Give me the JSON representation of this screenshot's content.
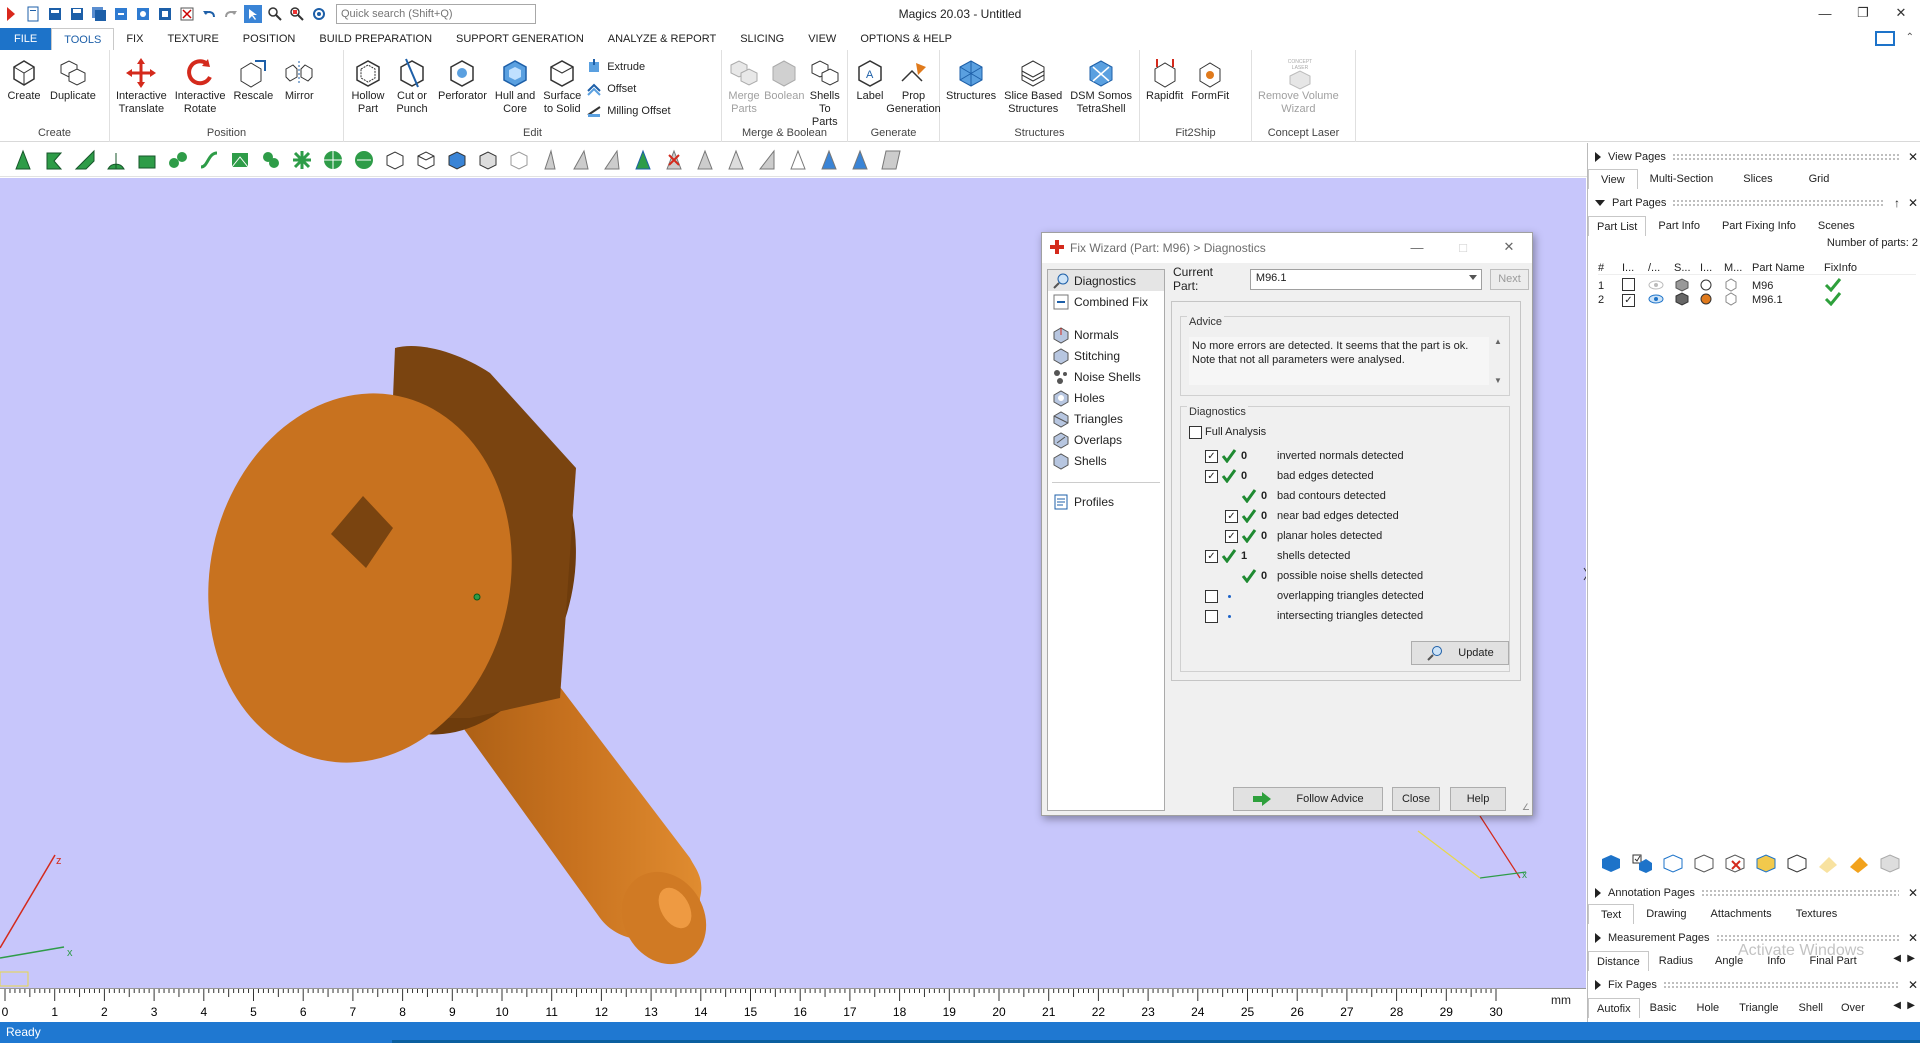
{
  "app": {
    "title": "Magics 20.03 - Untitled"
  },
  "search": {
    "placeholder": "Quick search (Shift+Q)"
  },
  "menu": {
    "items": [
      "FILE",
      "TOOLS",
      "FIX",
      "TEXTURE",
      "POSITION",
      "BUILD PREPARATION",
      "SUPPORT GENERATION",
      "ANALYZE & REPORT",
      "SLICING",
      "VIEW",
      "OPTIONS & HELP"
    ],
    "active": "TOOLS"
  },
  "ribbon": {
    "create": {
      "group": "Create",
      "create": "Create",
      "duplicate": "Duplicate"
    },
    "position": {
      "group": "Position",
      "translate": "Interactive\nTranslate",
      "rotate": "Interactive\nRotate",
      "rescale": "Rescale",
      "mirror": "Mirror"
    },
    "edit": {
      "group": "Edit",
      "hollow": "Hollow\nPart",
      "cut": "Cut or\nPunch",
      "perforator": "Perforator",
      "hull": "Hull and\nCore",
      "surface": "Surface\nto Solid",
      "extrude": "Extrude",
      "offset": "Offset",
      "milling": "Milling Offset"
    },
    "merge": {
      "group": "Merge & Boolean",
      "merge": "Merge\nParts",
      "boolean": "Boolean",
      "shells": "Shells\nTo Parts"
    },
    "generate": {
      "group": "Generate",
      "label": "Label",
      "prop": "Prop\nGeneration"
    },
    "structures": {
      "group": "Structures",
      "structures": "Structures",
      "slice": "Slice Based\nStructures",
      "dsm": "DSM Somos\nTetraShell"
    },
    "fit2ship": {
      "group": "Fit2Ship",
      "rapidfit": "Rapidfit",
      "formfit": "FormFit"
    },
    "concept": {
      "group": "Concept Laser",
      "remove": "Remove Volume\nWizard",
      "logo_text": "CONCEPT LASER"
    }
  },
  "viewport": {
    "ruler_ticks": [
      "0",
      "1",
      "2",
      "3",
      "4",
      "5",
      "6",
      "7",
      "8",
      "9",
      "10",
      "11",
      "12",
      "13",
      "14",
      "15",
      "16",
      "17",
      "18",
      "19",
      "20",
      "21",
      "22",
      "23",
      "24",
      "25",
      "26",
      "27",
      "28",
      "29",
      "30"
    ],
    "ruler_unit": "mm",
    "axis_z": "z",
    "axis_x": "x",
    "part_color": "#c8721f",
    "background": "#c7c6fb"
  },
  "dialog": {
    "title": "Fix Wizard (Part: M96) > Diagnostics",
    "nav": [
      "Diagnostics",
      "Combined Fix",
      "Normals",
      "Stitching",
      "Noise Shells",
      "Holes",
      "Triangles",
      "Overlaps",
      "Shells",
      "Profiles"
    ],
    "current_part_label": "Current Part:",
    "current_part_value": "M96.1",
    "next": "Next",
    "advice_title": "Advice",
    "advice_text": "No more errors are detected. It seems that the part is ok. Note that not all parameters were analysed.",
    "diagnostics_title": "Diagnostics",
    "full_analysis": "Full Analysis",
    "rows": [
      {
        "count": "0",
        "label": "inverted normals detected"
      },
      {
        "count": "0",
        "label": "bad edges detected"
      },
      {
        "count": "0",
        "label": "bad contours detected"
      },
      {
        "count": "0",
        "label": "near bad edges detected"
      },
      {
        "count": "0",
        "label": "planar holes detected"
      },
      {
        "count": "1",
        "label": "shells detected"
      },
      {
        "count": "0",
        "label": "possible noise shells detected"
      },
      {
        "count": "",
        "label": "overlapping triangles detected"
      },
      {
        "count": "",
        "label": "intersecting triangles detected"
      }
    ],
    "update": "Update",
    "follow_advice": "Follow Advice",
    "close": "Close",
    "help": "Help"
  },
  "right_panel": {
    "view_pages": "View Pages",
    "view_tabs": [
      "View",
      "Multi-Section",
      "Slices",
      "Grid"
    ],
    "part_pages": "Part Pages",
    "part_tabs": [
      "Part List",
      "Part Info",
      "Part Fixing Info",
      "Scenes"
    ],
    "number_of_parts": "Number of parts: 2",
    "columns": [
      "#",
      "I...",
      "/...",
      "S...",
      "I...",
      "M...",
      "Part Name",
      "FixInfo"
    ],
    "parts": [
      {
        "num": "1",
        "name": "M96"
      },
      {
        "num": "2",
        "name": "M96.1"
      }
    ],
    "annotation_pages": "Annotation Pages",
    "annotation_tabs": [
      "Text",
      "Drawing",
      "Attachments",
      "Textures"
    ],
    "measurement_pages": "Measurement Pages",
    "measurement_tabs": [
      "Distance",
      "Radius",
      "Angle",
      "Info",
      "Final Part"
    ],
    "fix_pages": "Fix Pages",
    "fix_tabs": [
      "Autofix",
      "Basic",
      "Hole",
      "Triangle",
      "Shell",
      "Over"
    ],
    "watermark": "Activate Windows"
  },
  "status": {
    "text": "Ready"
  }
}
